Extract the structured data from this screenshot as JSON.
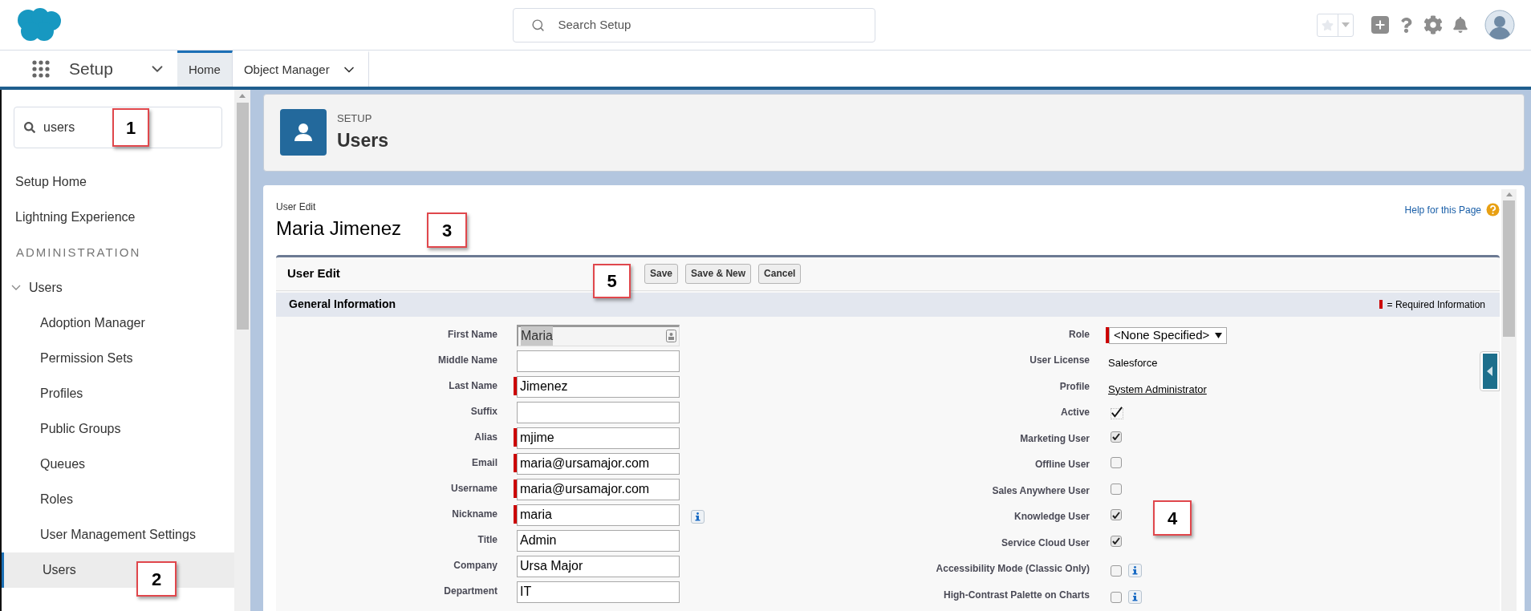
{
  "header": {
    "search": {
      "placeholder": "Search Setup"
    }
  },
  "nav": {
    "app_name": "Setup",
    "tabs": [
      {
        "label": "Home",
        "selected": true,
        "dropdown": false
      },
      {
        "label": "Object Manager",
        "selected": false,
        "dropdown": true
      }
    ]
  },
  "sidebar": {
    "search": {
      "value": "users"
    },
    "items": [
      {
        "label": "Setup Home",
        "selected": false
      },
      {
        "label": "Lightning Experience",
        "selected": false
      }
    ],
    "section": {
      "title": "ADMINISTRATION",
      "groups": [
        {
          "label": "Users",
          "expanded": true,
          "children": [
            {
              "label": "Adoption Manager",
              "selected": false
            },
            {
              "label": "Permission Sets",
              "selected": false
            },
            {
              "label": "Profiles",
              "selected": false
            },
            {
              "label": "Public Groups",
              "selected": false
            },
            {
              "label": "Queues",
              "selected": false
            },
            {
              "label": "Roles",
              "selected": false
            },
            {
              "label": "User Management Settings",
              "selected": false
            },
            {
              "label": "Users",
              "selected": true
            }
          ]
        }
      ]
    }
  },
  "page_header": {
    "eyebrow": "SETUP",
    "title": "Users"
  },
  "record": {
    "eyebrow": "User Edit",
    "title": "Maria Jimenez",
    "help_link": "Help for this Page"
  },
  "edit_block": {
    "title": "User Edit",
    "buttons": [
      "Save",
      "Save & New",
      "Cancel"
    ],
    "section": {
      "title": "General Information",
      "legend": "= Required Information",
      "left_fields": [
        {
          "label": "First Name",
          "value": "Maria",
          "required": false,
          "autofill": true,
          "info": false
        },
        {
          "label": "Middle Name",
          "required": false,
          "autofill": false,
          "info": false
        },
        {
          "label": "Last Name",
          "value": "Jimenez",
          "required": true,
          "autofill": false,
          "info": false
        },
        {
          "label": "Suffix",
          "required": false,
          "autofill": false,
          "info": false
        },
        {
          "label": "Alias",
          "value": "mjime",
          "required": true,
          "autofill": false,
          "info": false
        },
        {
          "label": "Email",
          "value": "maria@ursamajor.com",
          "required": true,
          "autofill": false,
          "info": false
        },
        {
          "label": "Username",
          "value": "maria@ursamajor.com",
          "required": true,
          "autofill": false,
          "info": false
        },
        {
          "label": "Nickname",
          "value": "maria",
          "required": true,
          "autofill": false,
          "info": true
        },
        {
          "label": "Title",
          "value": "Admin",
          "required": false,
          "autofill": false,
          "info": false
        },
        {
          "label": "Company",
          "value": "Ursa Major",
          "required": false,
          "autofill": false,
          "info": false
        },
        {
          "label": "Department",
          "value": "IT",
          "required": false,
          "autofill": false,
          "info": false
        }
      ],
      "right_fields": [
        {
          "kind": "select",
          "label": "Role",
          "value": "<None Specified>",
          "required": true
        },
        {
          "kind": "text",
          "label": "User License",
          "value": "Salesforce"
        },
        {
          "kind": "link",
          "label": "Profile",
          "value": "System Administrator"
        },
        {
          "kind": "tick",
          "label": "Active",
          "checked": true
        },
        {
          "kind": "checkbox",
          "label": "Marketing User",
          "checked": true,
          "info": false
        },
        {
          "kind": "checkbox",
          "label": "Offline User",
          "checked": false,
          "info": false
        },
        {
          "kind": "checkbox",
          "label": "Sales Anywhere User",
          "checked": false,
          "info": false
        },
        {
          "kind": "checkbox",
          "label": "Knowledge User",
          "checked": true,
          "info": false
        },
        {
          "kind": "checkbox",
          "label": "Service Cloud User",
          "checked": true,
          "info": false
        },
        {
          "kind": "checkbox",
          "label": "Accessibility Mode (Classic Only)",
          "checked": false,
          "info": true
        },
        {
          "kind": "checkbox",
          "label": "High-Contrast Palette on Charts",
          "checked": false,
          "info": true
        }
      ]
    }
  },
  "callouts": [
    "1",
    "2",
    "3",
    "4",
    "5"
  ]
}
